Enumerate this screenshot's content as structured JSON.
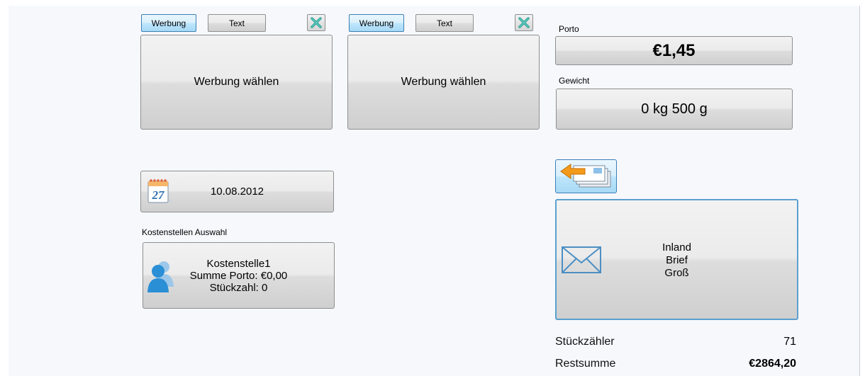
{
  "ad_panel_1": {
    "tab_werbung": "Werbung",
    "tab_text": "Text",
    "select_label": "Werbung wählen",
    "clear_icon": "green-x-icon"
  },
  "ad_panel_2": {
    "tab_werbung": "Werbung",
    "tab_text": "Text",
    "select_label": "Werbung wählen",
    "clear_icon": "green-x-icon"
  },
  "date": {
    "icon": "calendar-icon",
    "value": "10.08.2012"
  },
  "cost_center": {
    "section_label": "Kostenstellen Auswahl",
    "icon": "users-icon",
    "name": "Kostenstelle1",
    "sum_postage": "Summe Porto: €0,00",
    "piece_count": "Stückzahl: 0"
  },
  "postage": {
    "label": "Porto",
    "value": "€1,45"
  },
  "weight": {
    "label": "Gewicht",
    "value": "0 kg 500 g"
  },
  "back_button": {
    "icon": "back-letters-icon"
  },
  "product": {
    "icon": "envelope-icon",
    "line1": "Inland",
    "line2": "Brief",
    "line3": "Groß"
  },
  "summary": {
    "counter_label": "Stückzähler",
    "counter_value": "71",
    "remaining_label": "Restsumme",
    "remaining_value": "€2864,20"
  },
  "colors": {
    "panel_bg": "#f7f8fc",
    "active_border": "#3c7fb1",
    "accent_green": "#2aa198"
  }
}
